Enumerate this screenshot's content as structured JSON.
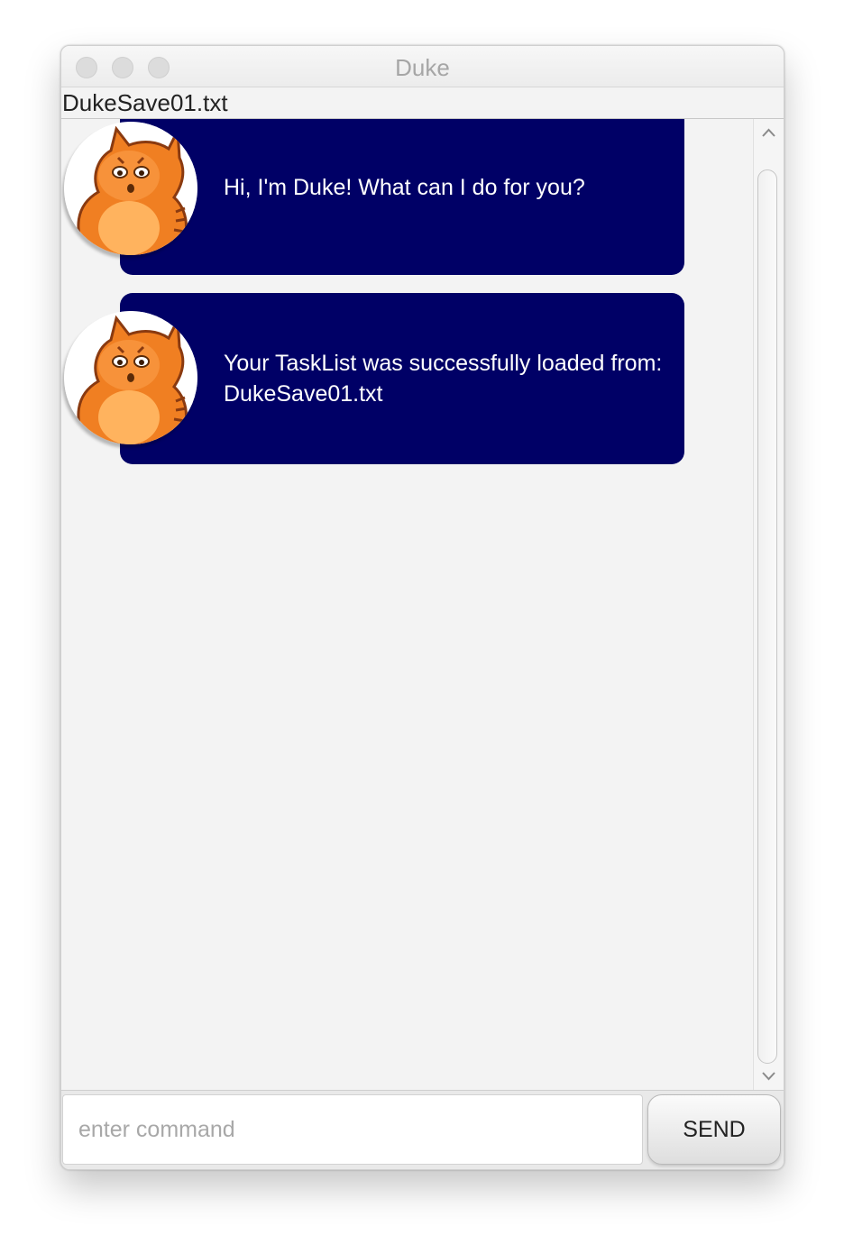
{
  "window": {
    "title": "Duke"
  },
  "file": {
    "name": "DukeSave01.txt"
  },
  "messages": [
    {
      "sender": "Duke",
      "text": "Hi, I'm Duke! What can I do for you?"
    },
    {
      "sender": "Duke",
      "text": "Your TaskList was successfully loaded from: DukeSave01.txt"
    }
  ],
  "input": {
    "placeholder": "enter command",
    "value": ""
  },
  "send_button": {
    "label": "SEND"
  },
  "colors": {
    "bubble": "#000066",
    "bubble_text": "#ffffff",
    "chat_bg": "#f3f3f3"
  },
  "icons": {
    "avatar": "orange-cat-avatar-icon",
    "scroll_up": "chevron-up-icon",
    "scroll_down": "chevron-down-icon"
  }
}
